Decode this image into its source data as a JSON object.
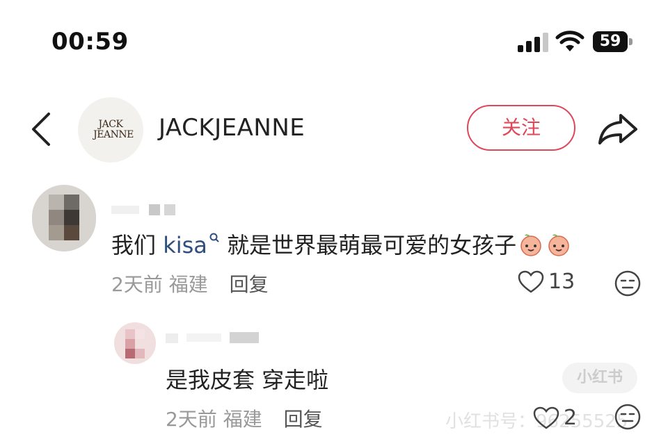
{
  "status_bar": {
    "time": "00:59",
    "battery": "59"
  },
  "header": {
    "logo_line1": "JACK",
    "logo_line2": "JEANNE",
    "account_name": "JACKJEANNE",
    "follow_label": "关注"
  },
  "comments": [
    {
      "text_before": "我们 ",
      "mention": "kisa",
      "text_after": " 就是世界最萌最可爱的女孩子",
      "time": "2天前",
      "location": "福建",
      "reply_label": "回复",
      "likes": "13"
    },
    {
      "text": "是我皮套 穿走啦",
      "time": "2天前",
      "location": "福建",
      "reply_label": "回复",
      "likes": "2"
    }
  ],
  "watermark": {
    "text": "小红书号：96255525",
    "badge": "小红书"
  },
  "colors": {
    "accent": "#e0475a",
    "mention": "#2f4f7f",
    "meta": "#999999"
  }
}
